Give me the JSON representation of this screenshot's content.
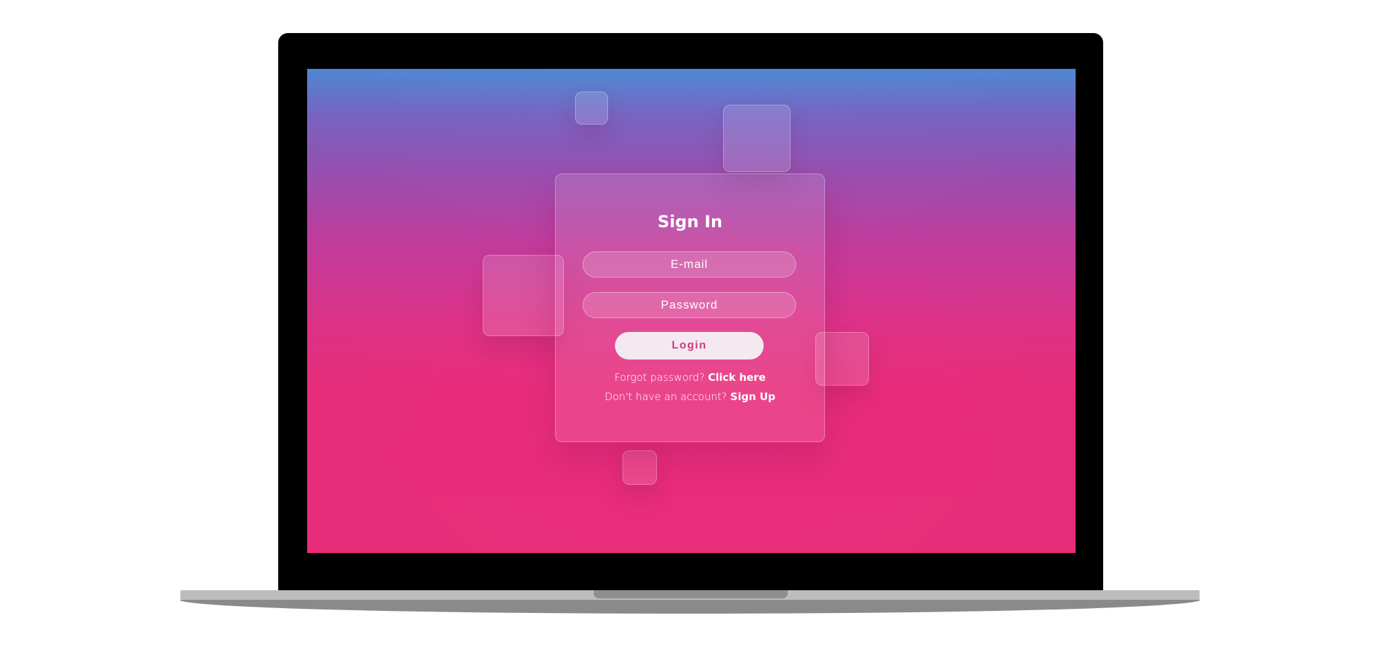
{
  "card": {
    "title": "Sign In",
    "email_placeholder": "E-mail",
    "password_placeholder": "Password",
    "login_label": "Login",
    "forgot_text": "Forgot password?",
    "forgot_link": "Click here",
    "signup_text": "Don't have an account?",
    "signup_link": "Sign Up"
  },
  "colors": {
    "gradient_top": "#4f8ad6",
    "gradient_mid": "#c23c9c",
    "gradient_bottom": "#e92d7a",
    "button_text": "#d0387e"
  }
}
